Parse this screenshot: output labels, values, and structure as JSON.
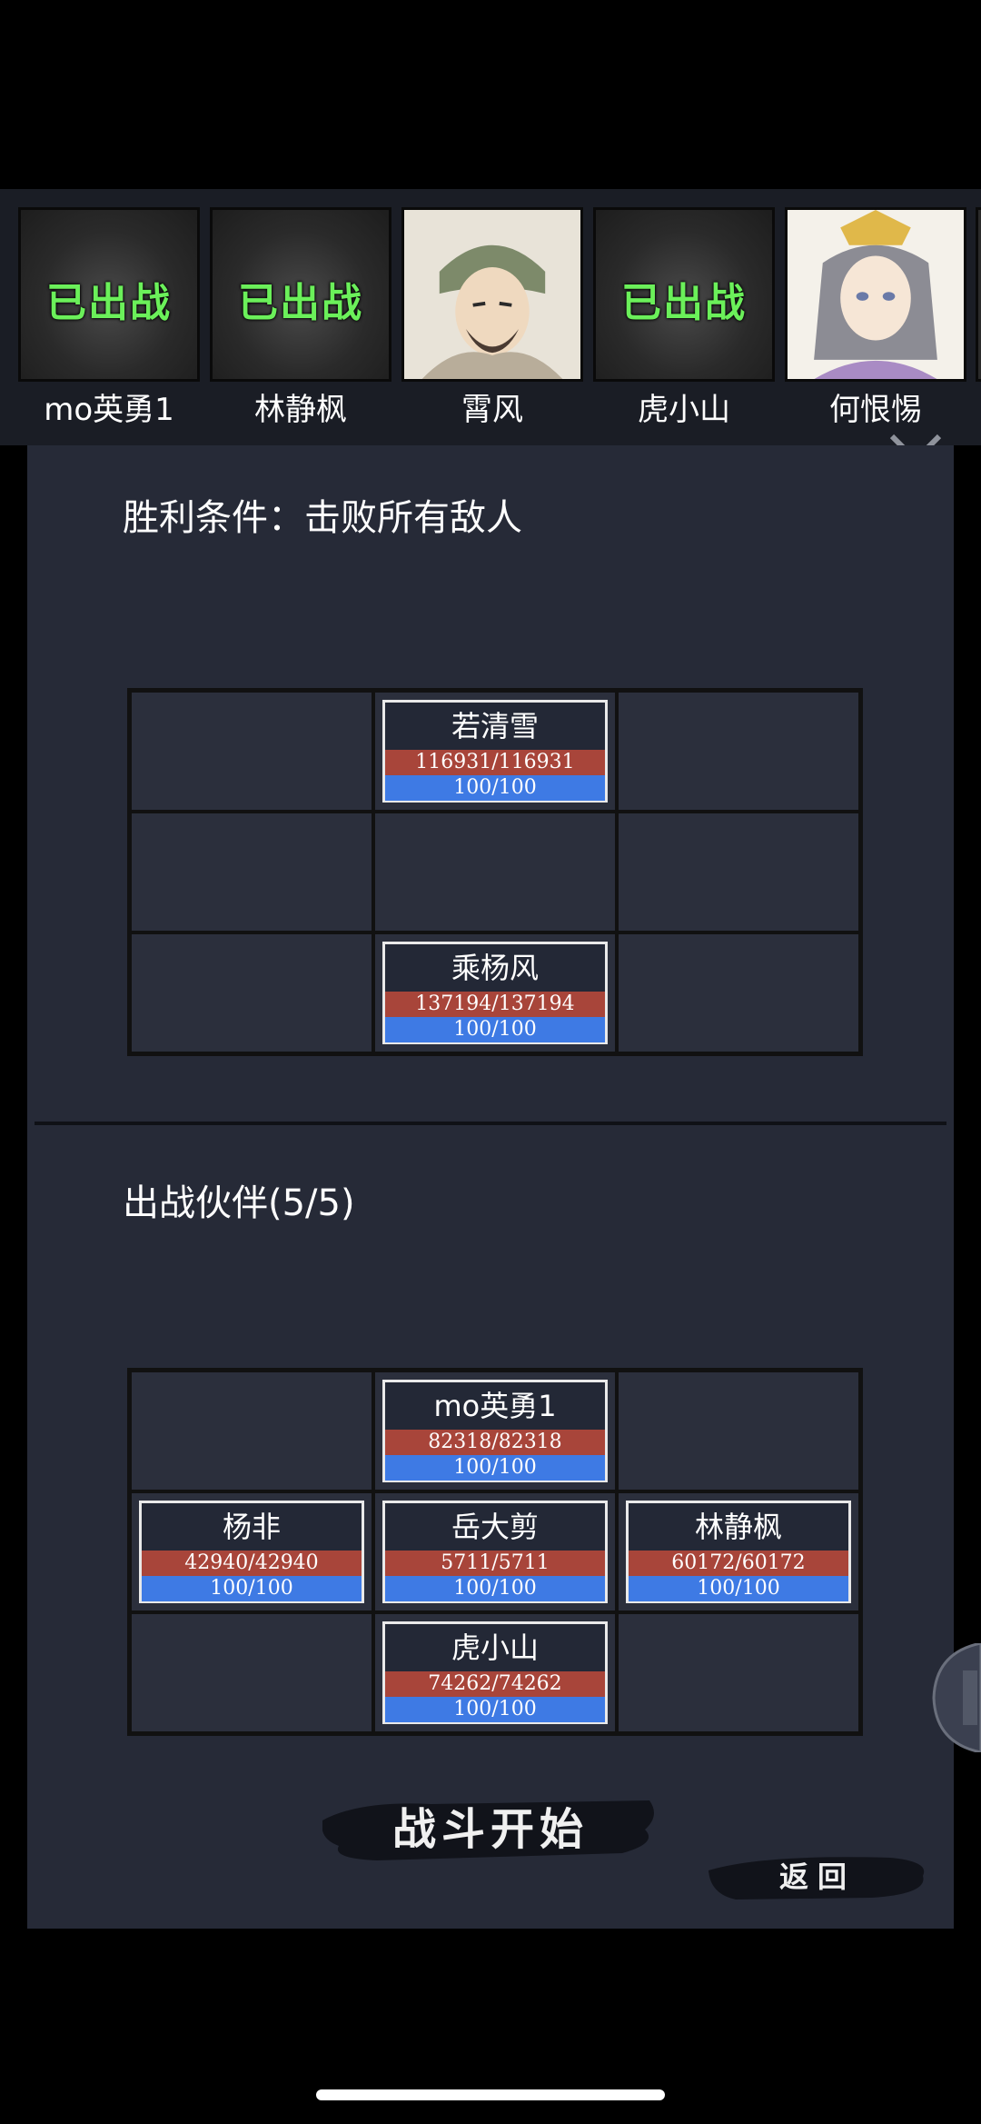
{
  "roster": [
    {
      "name": "mo英勇1",
      "status": "已出战",
      "deployed": true
    },
    {
      "name": "林静枫",
      "status": "已出战",
      "deployed": true
    },
    {
      "name": "霄风",
      "status": "",
      "deployed": false
    },
    {
      "name": "虎小山",
      "status": "已出战",
      "deployed": true
    },
    {
      "name": "何恨惕",
      "status": "",
      "deployed": false
    }
  ],
  "victory": {
    "title": "胜利条件：击败所有敌人"
  },
  "enemy_grid": {
    "top_center": {
      "name": "若清雪",
      "hp": "116931/116931",
      "mp": "100/100"
    },
    "bottom_center": {
      "name": "乘杨风",
      "hp": "137194/137194",
      "mp": "100/100"
    }
  },
  "party": {
    "title": "出战伙伴(5/5)"
  },
  "party_grid": {
    "top_center": {
      "name": "mo英勇1",
      "hp": "82318/82318",
      "mp": "100/100"
    },
    "mid_left": {
      "name": "杨非",
      "hp": "42940/42940",
      "mp": "100/100"
    },
    "mid_center": {
      "name": "岳大剪",
      "hp": "5711/5711",
      "mp": "100/100"
    },
    "mid_right": {
      "name": "林静枫",
      "hp": "60172/60172",
      "mp": "100/100"
    },
    "bottom_center": {
      "name": "虎小山",
      "hp": "74262/74262",
      "mp": "100/100"
    }
  },
  "buttons": {
    "start": "战斗开始",
    "back": "返回"
  }
}
